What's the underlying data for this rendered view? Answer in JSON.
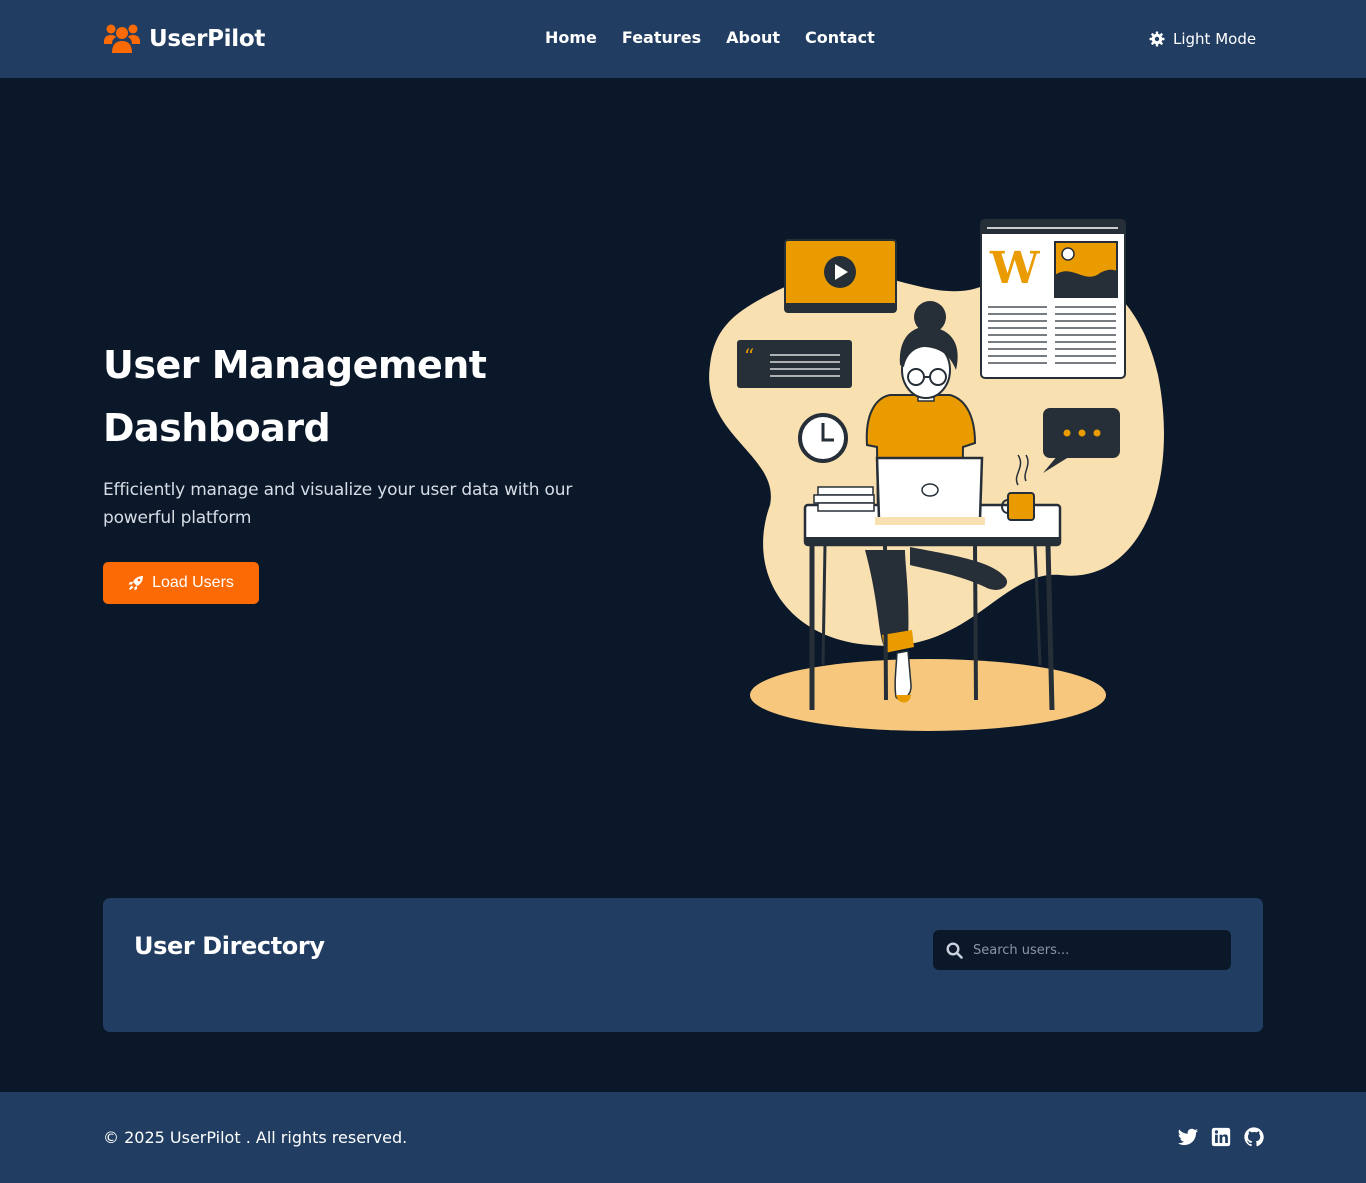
{
  "brand": {
    "name": "UserPilot",
    "icon": "users-icon",
    "icon_color": "#fb6a05"
  },
  "nav": {
    "links": [
      "Home",
      "Features",
      "About",
      "Contact"
    ]
  },
  "theme_toggle": {
    "label": "Light Mode",
    "icon": "gear-icon"
  },
  "hero": {
    "title": "User Management Dashboard",
    "subtitle": "Efficiently manage and visualize your user data with our powerful platform",
    "button_label": "Load Users",
    "button_icon": "rocket-icon",
    "button_color": "#fb6a05"
  },
  "directory": {
    "title": "User Directory",
    "search_placeholder": "Search users..."
  },
  "footer": {
    "copyright": "© 2025 UserPilot . All rights reserved.",
    "socials": [
      "twitter-icon",
      "linkedin-icon",
      "github-icon"
    ]
  },
  "colors": {
    "background": "#0b1829",
    "panel": "#213e62",
    "accent": "#fb6a05",
    "illustration_accent": "#e99b00"
  }
}
